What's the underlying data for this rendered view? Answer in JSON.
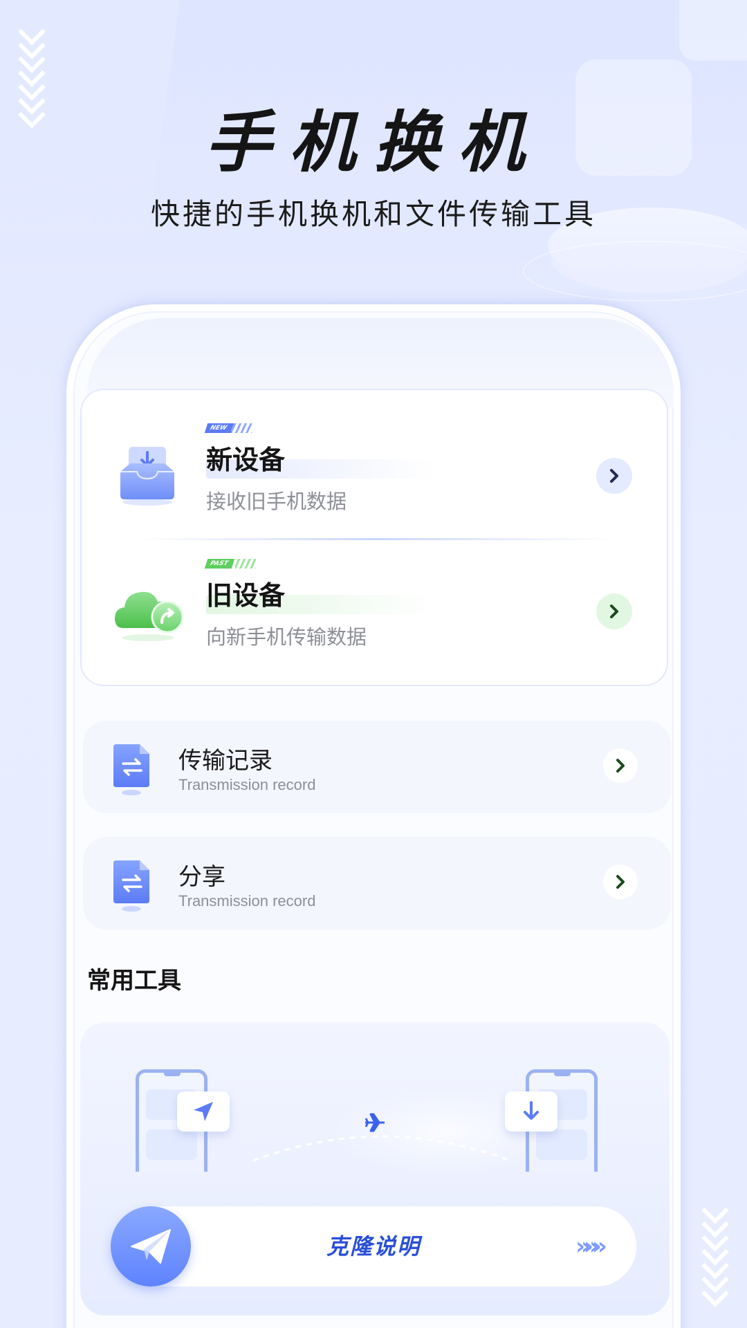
{
  "header": {
    "title": "手机换机",
    "subtitle": "快捷的手机换机和文件传输工具"
  },
  "devices": {
    "new": {
      "tag": "NEW",
      "title": "新设备",
      "desc": "接收旧手机数据",
      "icon": "inbox-download-icon",
      "accent": "#5b7cf5"
    },
    "old": {
      "tag": "PAST",
      "title": "旧设备",
      "desc": "向新手机传输数据",
      "icon": "cloud-share-icon",
      "accent": "#5fcf5f"
    }
  },
  "list": [
    {
      "title": "传输记录",
      "subtitle": "Transmission record",
      "icon": "document-transfer-icon"
    },
    {
      "title": "分享",
      "subtitle": "Transmission record",
      "icon": "document-transfer-icon"
    }
  ],
  "tools": {
    "section_title": "常用工具",
    "clone_label": "克隆说明",
    "clone_arrows": "»»»"
  },
  "colors": {
    "background": "#e3e9ff",
    "primary": "#5e83ff",
    "clone_text": "#2a4fd6",
    "green": "#5fcf5f"
  }
}
